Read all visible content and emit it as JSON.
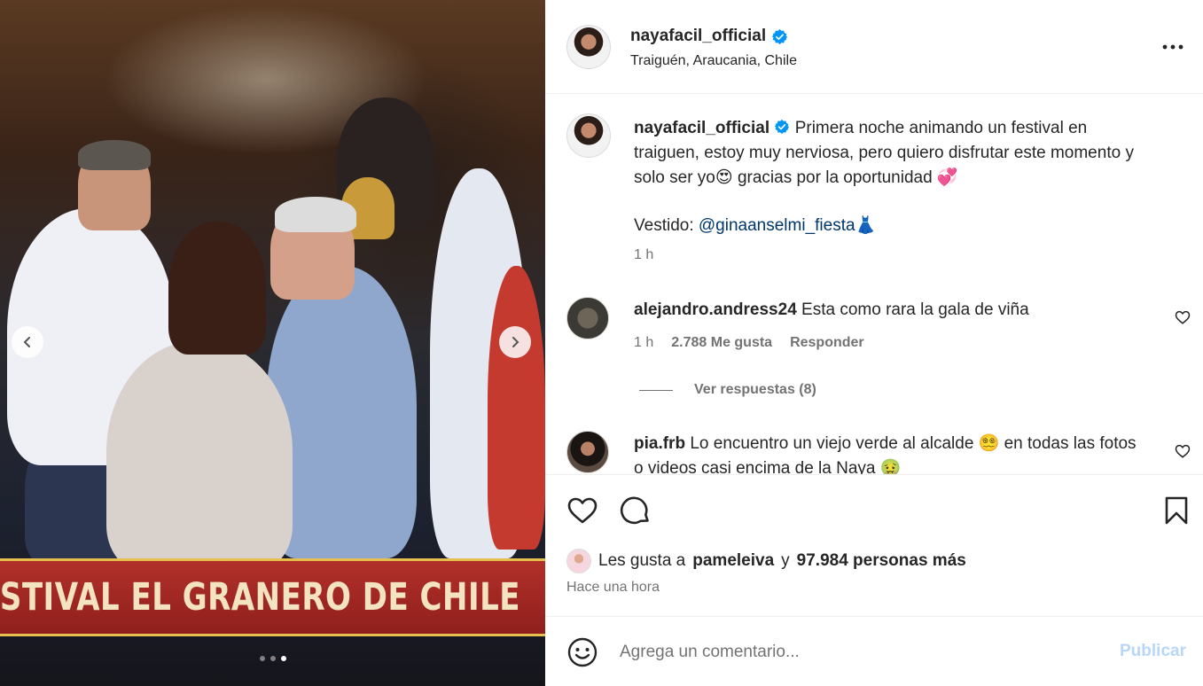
{
  "media": {
    "banner_text": "OMIENZA EL FESTIVAL EL GRANERO DE CHILE",
    "prev_icon": "chevron-left-icon",
    "next_icon": "chevron-right-icon",
    "slide_count": 3,
    "active_slide": 3
  },
  "header": {
    "username": "nayafacil_official",
    "location": "Traiguén, Araucania, Chile",
    "verified_icon": "verified-badge-icon",
    "more_icon": "more-options-icon"
  },
  "caption": {
    "username": "nayafacil_official",
    "text": "Primera noche animando un festival en traiguen, estoy muy nerviosa, pero quiero disfrutar este momento y solo ser yo😍 gracias por la oportunidad 💞",
    "credit_label": "Vestido:",
    "credit_mention": "@ginaanselmi_fiesta",
    "credit_emoji": "👗",
    "time": "1 h"
  },
  "comments": [
    {
      "username": "alejandro.andress24",
      "text": "Esta como rara la gala de viña",
      "time": "1 h",
      "likes": "2.788 Me gusta",
      "reply_label": "Responder",
      "view_replies": "Ver respuestas (8)"
    },
    {
      "username": "pia.frb",
      "text": "Lo encuentro un viejo verde al alcalde 😵‍💫 en todas las fotos o videos casi encima de la Naya 🤢"
    }
  ],
  "actions": {
    "like_icon": "heart-icon",
    "comment_icon": "comment-icon",
    "save_icon": "bookmark-icon",
    "likes_prefix": "Les gusta a",
    "likes_user": "pameleiva",
    "likes_conj": "y",
    "likes_count": "97.984 personas más",
    "posted": "Hace una hora"
  },
  "add_comment": {
    "placeholder": "Agrega un comentario...",
    "publish": "Publicar",
    "emoji_icon": "emoji-icon"
  },
  "colors": {
    "link": "#00376b",
    "muted": "#737373",
    "verified": "#0095f6",
    "publish_disabled": "#b8d6f8",
    "banner_red": "#b2302a"
  }
}
